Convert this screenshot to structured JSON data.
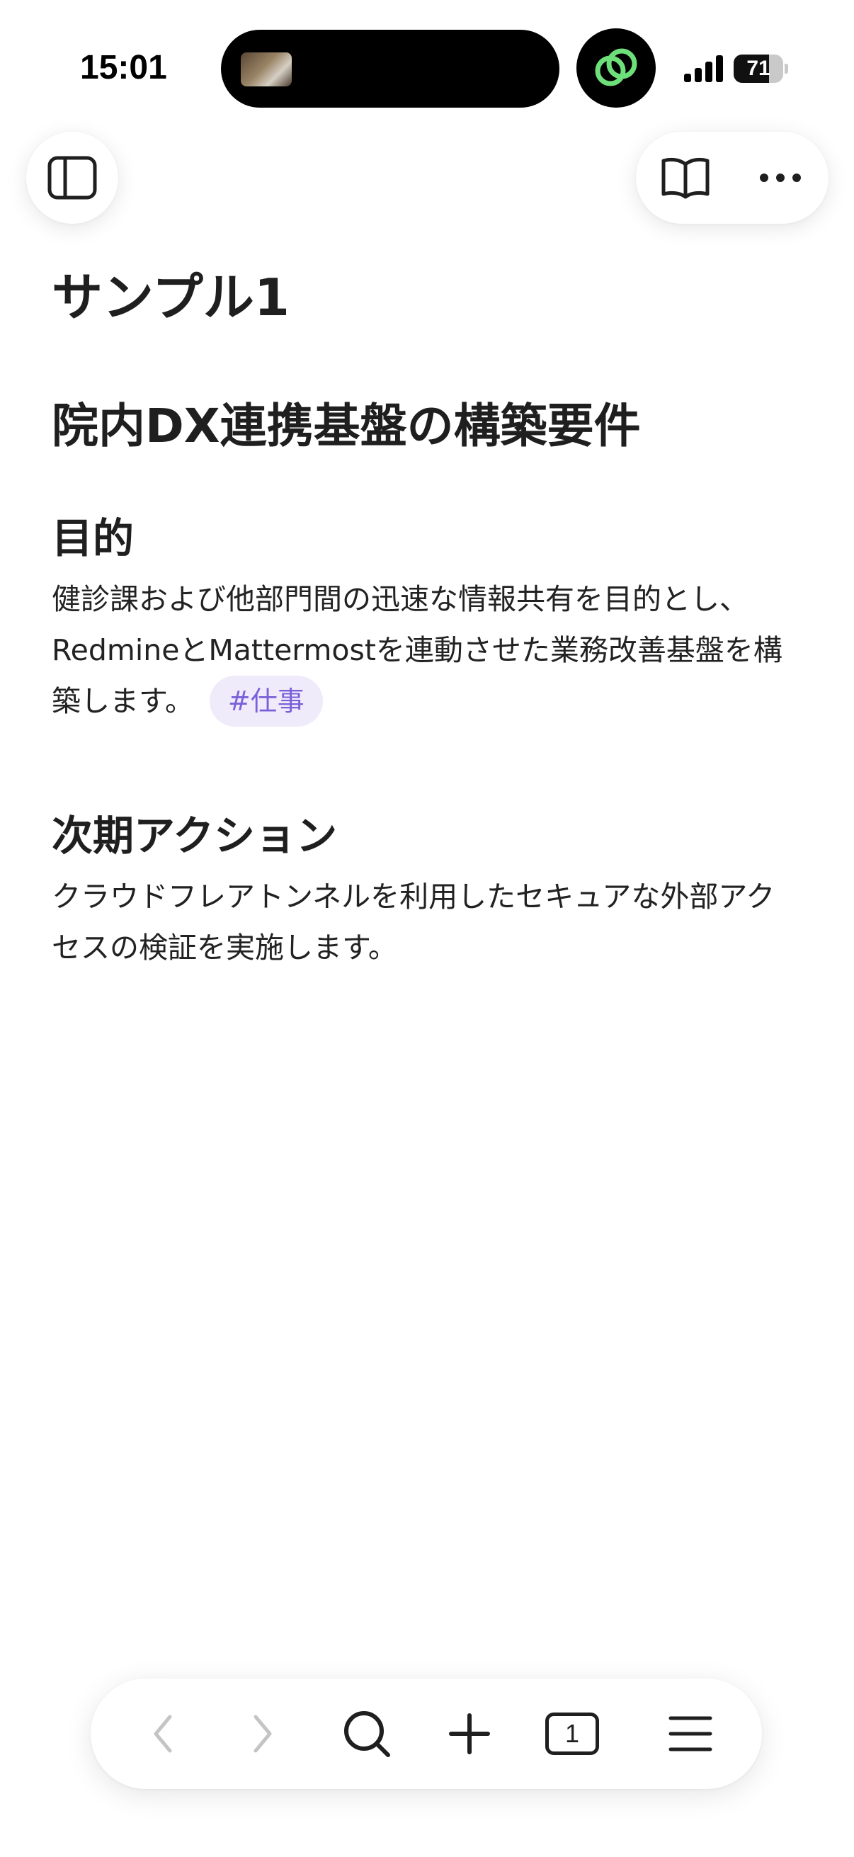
{
  "status_bar": {
    "time": "15:01",
    "battery_level": "71",
    "battery_fraction": 0.71
  },
  "top_bar": {
    "sidebar_icon": "sidebar-icon",
    "reader_icon": "open-book-icon",
    "more_icon": "ellipsis-icon"
  },
  "note": {
    "title": "サンプル1",
    "heading": "院内DX連携基盤の構築要件",
    "sections": [
      {
        "heading": "目的",
        "body": "健診課および他部門間の迅速な情報共有を目的とし、RedmineとMattermostを連動させた業務改善基盤を構築します。",
        "tag": "#仕事"
      },
      {
        "heading": "次期アクション",
        "body": "クラウドフレアトンネルを利用したセキュアな外部アクセスの検証を実施します。"
      }
    ]
  },
  "toolbar": {
    "back_icon": "chevron-left-icon",
    "forward_icon": "chevron-right-icon",
    "search_icon": "search-icon",
    "add_icon": "plus-icon",
    "tab_count": "1",
    "menu_icon": "hamburger-menu-icon"
  },
  "colors": {
    "tag_background": "#f0ebfb",
    "tag_text": "#7b61d9",
    "live_activity_green": "#6ee07a"
  }
}
